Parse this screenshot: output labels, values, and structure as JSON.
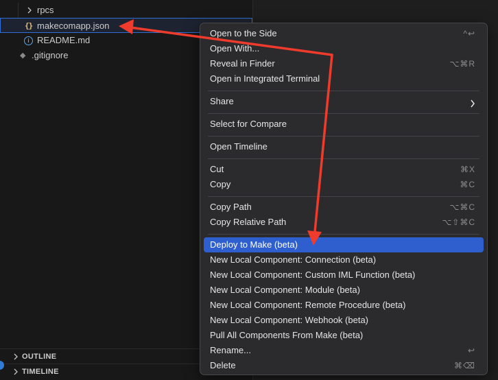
{
  "explorer": {
    "rows": [
      {
        "label": "rpcs"
      },
      {
        "label": "makecomapp.json"
      },
      {
        "label": "README.md"
      },
      {
        "label": ".gitignore"
      }
    ],
    "json_icon_glyph": "{}",
    "info_icon_glyph": "i",
    "git_icon_glyph": "◆",
    "sections": [
      {
        "label": "OUTLINE"
      },
      {
        "label": "TIMELINE"
      }
    ]
  },
  "menu": {
    "items": [
      {
        "label": "Open to the Side",
        "shortcut": "^↩"
      },
      {
        "label": "Open With...",
        "shortcut": ""
      },
      {
        "label": "Reveal in Finder",
        "shortcut": "⌥⌘R"
      },
      {
        "label": "Open in Integrated Terminal",
        "shortcut": ""
      },
      {
        "label": "Share",
        "shortcut": ""
      },
      {
        "label": "Select for Compare",
        "shortcut": ""
      },
      {
        "label": "Open Timeline",
        "shortcut": ""
      },
      {
        "label": "Cut",
        "shortcut": "⌘X"
      },
      {
        "label": "Copy",
        "shortcut": "⌘C"
      },
      {
        "label": "Copy Path",
        "shortcut": "⌥⌘C"
      },
      {
        "label": "Copy Relative Path",
        "shortcut": "⌥⇧⌘C"
      },
      {
        "label": "Deploy to Make (beta)",
        "shortcut": ""
      },
      {
        "label": "New Local Component: Connection (beta)",
        "shortcut": ""
      },
      {
        "label": "New Local Component: Custom IML Function (beta)",
        "shortcut": ""
      },
      {
        "label": "New Local Component: Module (beta)",
        "shortcut": ""
      },
      {
        "label": "New Local Component: Remote Procedure (beta)",
        "shortcut": ""
      },
      {
        "label": "New Local Component: Webhook (beta)",
        "shortcut": ""
      },
      {
        "label": "Pull All Components From Make (beta)",
        "shortcut": ""
      },
      {
        "label": "Rename...",
        "shortcut": "↩"
      },
      {
        "label": "Delete",
        "shortcut": "⌘⌫"
      }
    ]
  },
  "colors": {
    "menu_highlight": "#2f5fcf",
    "annotation_arrow": "#ef3b2c",
    "selection_border": "#2f6fd6"
  }
}
